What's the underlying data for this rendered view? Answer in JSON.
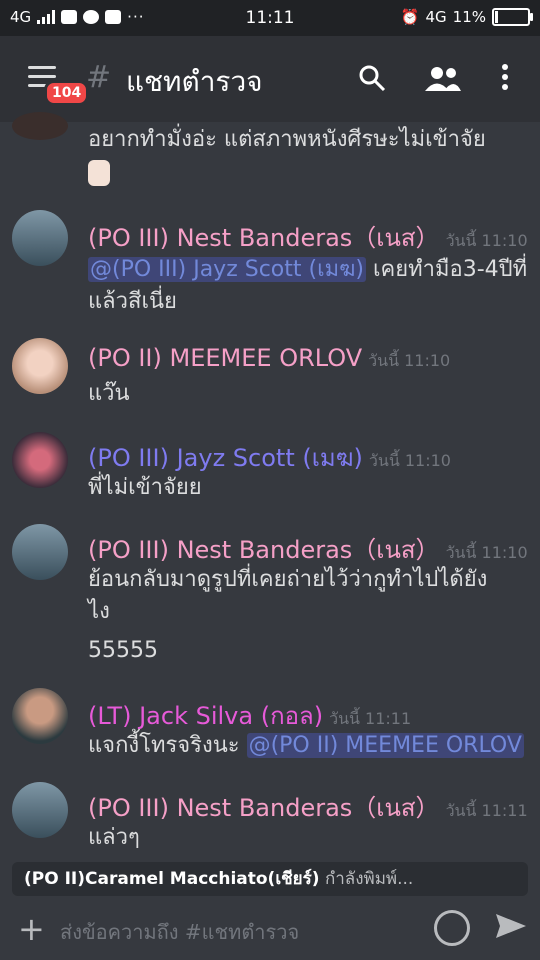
{
  "status_bar": {
    "network_left": "4G",
    "time": "11:11",
    "network_right": "4G",
    "battery": "11%",
    "battery_level": 0.11
  },
  "header": {
    "channel_name": "แชทตำรวจ",
    "badge_count": "104"
  },
  "messages": [
    {
      "text": "อยากทำมั่งอ่ะ แต่สภาพหนังศีรษะไม่เข้าจัย"
    },
    {
      "author": "(PO III) Nest Banderas（เนส）",
      "timestamp": "วันนี้ 11:10",
      "mention": "@(PO III) Jayz Scott (เมฆ)",
      "text_after": "เคยทำมือ3-4ปีที่",
      "text_line2": "แล้วสีเนี่ย",
      "author_color": "#f5a0c7"
    },
    {
      "author": "(PO II) MEEMEE ORLOV",
      "timestamp": "วันนี้ 11:10",
      "text": "แว๊น",
      "author_color": "#f5a0c7"
    },
    {
      "author": "(PO III) Jayz Scott (เมฆ)",
      "timestamp": "วันนี้ 11:10",
      "text": "พี่ไม่เข้าจัยย",
      "author_color": "#7f7bf0"
    },
    {
      "author": "(PO III) Nest Banderas（เนส）",
      "timestamp": "วันนี้ 11:10",
      "text_line1": "ย้อนกลับมาดูรูปที่เคยถ่ายไว้ว่ากูทำไปได้ยัง",
      "text_line2": "ไง",
      "text_line3": "55555",
      "author_color": "#f5a0c7"
    },
    {
      "author": "(LT) Jack Silva (กอล)",
      "timestamp": "วันนี้ 11:11",
      "text_before": "แจกงี้โทรจริงนะ",
      "mention": "@(PO II) MEEMEE ORLOV",
      "author_color": "#e75ad9"
    },
    {
      "author": "(PO III) Nest Banderas（เนส）",
      "timestamp": "วันนี้ 11:11",
      "text": "แล่วๆ",
      "author_color": "#f5a0c7"
    }
  ],
  "typing_indicator": {
    "user": "(PO II)Caramel Macchiato(เชียร์)",
    "suffix": "กำลังพิมพ์..."
  },
  "composer": {
    "placeholder": "ส่งข้อความถึง #แชทตำรวจ"
  }
}
